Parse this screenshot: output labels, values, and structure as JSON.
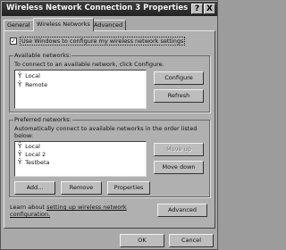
{
  "window": {
    "title": "Wireless Network Connection 3 Properties",
    "help_glyph": "?",
    "close_glyph": "X"
  },
  "tabs": [
    {
      "label": "General"
    },
    {
      "label": "Wireless Networks"
    },
    {
      "label": "Advanced"
    }
  ],
  "use_windows": {
    "checked": true,
    "label": "Use Windows to configure my wireless network settings"
  },
  "available": {
    "group_label": "Available networks:",
    "description": "To connect to an available network, click Configure.",
    "items": [
      "Local",
      "Remote"
    ],
    "configure_label": "Configure",
    "refresh_label": "Refresh"
  },
  "preferred": {
    "group_label": "Preferred networks:",
    "description_line1": "Automatically connect to available networks in the order listed",
    "description_line2": "below:",
    "items": [
      "Local",
      "Local 2",
      "Testbeta"
    ],
    "move_up_label": "Move up",
    "move_down_label": "Move down",
    "add_label": "Add...",
    "remove_label": "Remove",
    "properties_label": "Properties"
  },
  "learn": {
    "text_before": "Learn about",
    "link_text": "setting up wireless network",
    "link_text_2": "configuration.",
    "advanced_label": "Advanced"
  },
  "footer": {
    "ok_label": "OK",
    "cancel_label": "Cancel"
  }
}
